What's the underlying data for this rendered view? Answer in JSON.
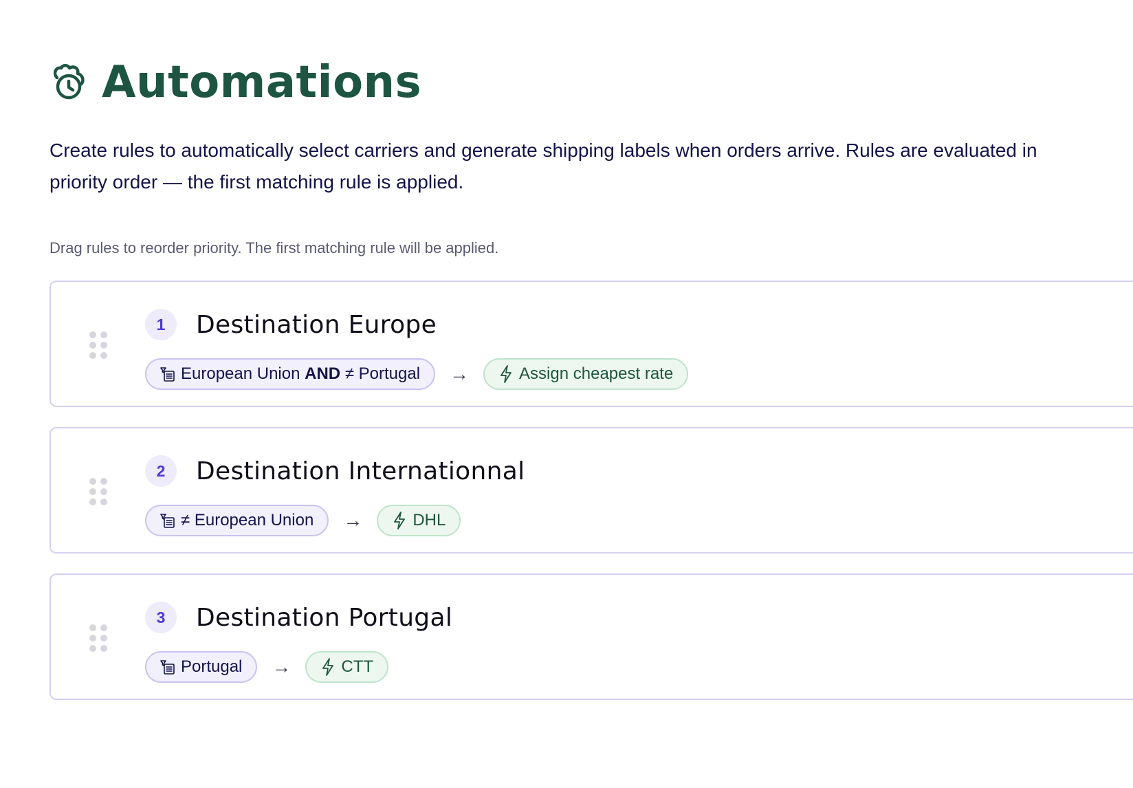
{
  "header": {
    "title": "Automations",
    "title_icon": "automation-clock-icon",
    "description": "Create rules to automatically select carriers and generate shipping labels when orders arrive. Rules are evaluated in priority order — the first matching rule is applied."
  },
  "rules_section": {
    "hint": "Drag rules to reorder priority. The first matching rule will be applied.",
    "arrow": "→",
    "rules": [
      {
        "priority": "1",
        "name": "Destination Europe",
        "condition": {
          "part1": "European Union",
          "operator": "AND",
          "part2": "≠ Portugal"
        },
        "action": "Assign cheapest rate"
      },
      {
        "priority": "2",
        "name": "Destination Internationnal",
        "condition": {
          "text": "≠ European Union"
        },
        "action": "DHL"
      },
      {
        "priority": "3",
        "name": "Destination Portugal",
        "condition": {
          "text": "Portugal"
        },
        "action": "CTT"
      }
    ]
  },
  "colors": {
    "brand_green": "#1e5542",
    "accent_purple": "#4b3ad6",
    "condition_bg": "#f2f0fd",
    "action_bg": "#edf7f0"
  }
}
